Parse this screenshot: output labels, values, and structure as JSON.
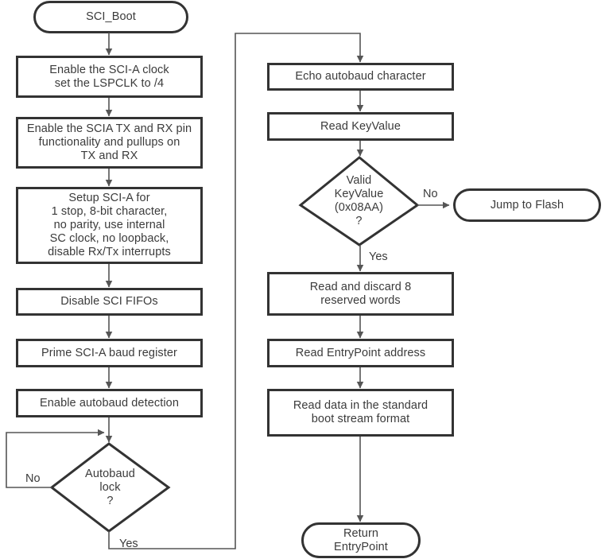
{
  "diagram": {
    "title": "SCI_Boot flowchart",
    "colors": {
      "stroke": "#333333",
      "text": "#3b3b3b",
      "connector": "#555555",
      "background": "#ffffff"
    }
  },
  "nodes": {
    "start": {
      "label": "SCI_Boot",
      "shape": "terminal"
    },
    "enable_clock": {
      "label": "Enable the SCI-A clock\nset the LSPCLK to /4",
      "shape": "process"
    },
    "enable_pins": {
      "label": "Enable the SCIA TX and RX pin\nfunctionality and pullups on\nTX and RX",
      "shape": "process"
    },
    "setup_scia": {
      "label": "Setup SCI-A for\n1 stop, 8-bit character,\nno parity, use internal\nSC clock, no loopback,\ndisable Rx/Tx interrupts",
      "shape": "process"
    },
    "disable_fifos": {
      "label": "Disable SCI FIFOs",
      "shape": "process"
    },
    "prime_baud": {
      "label": "Prime SCI-A baud register",
      "shape": "process"
    },
    "enable_autobaud": {
      "label": "Enable autobaud detection",
      "shape": "process"
    },
    "autobaud_lock": {
      "label": "Autobaud\nlock\n?",
      "shape": "decision"
    },
    "echo_char": {
      "label": "Echo autobaud character",
      "shape": "process"
    },
    "read_keyvalue": {
      "label": "Read KeyValue",
      "shape": "process"
    },
    "valid_keyvalue": {
      "label": "Valid\nKeyValue\n(0x08AA)\n?",
      "shape": "decision"
    },
    "jump_to_flash": {
      "label": "Jump to Flash",
      "shape": "terminal"
    },
    "read_discard": {
      "label": "Read and discard 8\nreserved words",
      "shape": "process"
    },
    "read_entrypoint": {
      "label": "Read EntryPoint address",
      "shape": "process"
    },
    "read_data": {
      "label": "Read data in the standard\nboot stream format",
      "shape": "process"
    },
    "return_entrypoint": {
      "label": "Return\nEntryPoint",
      "shape": "terminal"
    }
  },
  "edge_labels": {
    "autobaud_no": "No",
    "autobaud_yes": "Yes",
    "keyvalue_no": "No",
    "keyvalue_yes": "Yes"
  }
}
